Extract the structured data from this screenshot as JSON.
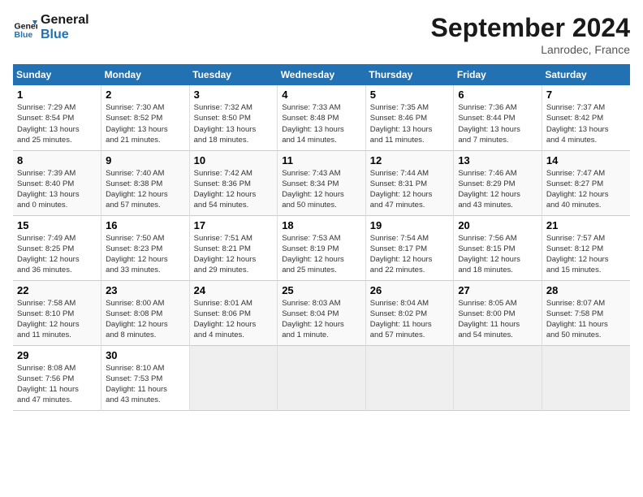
{
  "header": {
    "logo_line1": "General",
    "logo_line2": "Blue",
    "month": "September 2024",
    "location": "Lanrodec, France"
  },
  "days_of_week": [
    "Sunday",
    "Monday",
    "Tuesday",
    "Wednesday",
    "Thursday",
    "Friday",
    "Saturday"
  ],
  "weeks": [
    [
      {
        "day": "1",
        "info": "Sunrise: 7:29 AM\nSunset: 8:54 PM\nDaylight: 13 hours\nand 25 minutes."
      },
      {
        "day": "2",
        "info": "Sunrise: 7:30 AM\nSunset: 8:52 PM\nDaylight: 13 hours\nand 21 minutes."
      },
      {
        "day": "3",
        "info": "Sunrise: 7:32 AM\nSunset: 8:50 PM\nDaylight: 13 hours\nand 18 minutes."
      },
      {
        "day": "4",
        "info": "Sunrise: 7:33 AM\nSunset: 8:48 PM\nDaylight: 13 hours\nand 14 minutes."
      },
      {
        "day": "5",
        "info": "Sunrise: 7:35 AM\nSunset: 8:46 PM\nDaylight: 13 hours\nand 11 minutes."
      },
      {
        "day": "6",
        "info": "Sunrise: 7:36 AM\nSunset: 8:44 PM\nDaylight: 13 hours\nand 7 minutes."
      },
      {
        "day": "7",
        "info": "Sunrise: 7:37 AM\nSunset: 8:42 PM\nDaylight: 13 hours\nand 4 minutes."
      }
    ],
    [
      {
        "day": "8",
        "info": "Sunrise: 7:39 AM\nSunset: 8:40 PM\nDaylight: 13 hours\nand 0 minutes."
      },
      {
        "day": "9",
        "info": "Sunrise: 7:40 AM\nSunset: 8:38 PM\nDaylight: 12 hours\nand 57 minutes."
      },
      {
        "day": "10",
        "info": "Sunrise: 7:42 AM\nSunset: 8:36 PM\nDaylight: 12 hours\nand 54 minutes."
      },
      {
        "day": "11",
        "info": "Sunrise: 7:43 AM\nSunset: 8:34 PM\nDaylight: 12 hours\nand 50 minutes."
      },
      {
        "day": "12",
        "info": "Sunrise: 7:44 AM\nSunset: 8:31 PM\nDaylight: 12 hours\nand 47 minutes."
      },
      {
        "day": "13",
        "info": "Sunrise: 7:46 AM\nSunset: 8:29 PM\nDaylight: 12 hours\nand 43 minutes."
      },
      {
        "day": "14",
        "info": "Sunrise: 7:47 AM\nSunset: 8:27 PM\nDaylight: 12 hours\nand 40 minutes."
      }
    ],
    [
      {
        "day": "15",
        "info": "Sunrise: 7:49 AM\nSunset: 8:25 PM\nDaylight: 12 hours\nand 36 minutes."
      },
      {
        "day": "16",
        "info": "Sunrise: 7:50 AM\nSunset: 8:23 PM\nDaylight: 12 hours\nand 33 minutes."
      },
      {
        "day": "17",
        "info": "Sunrise: 7:51 AM\nSunset: 8:21 PM\nDaylight: 12 hours\nand 29 minutes."
      },
      {
        "day": "18",
        "info": "Sunrise: 7:53 AM\nSunset: 8:19 PM\nDaylight: 12 hours\nand 25 minutes."
      },
      {
        "day": "19",
        "info": "Sunrise: 7:54 AM\nSunset: 8:17 PM\nDaylight: 12 hours\nand 22 minutes."
      },
      {
        "day": "20",
        "info": "Sunrise: 7:56 AM\nSunset: 8:15 PM\nDaylight: 12 hours\nand 18 minutes."
      },
      {
        "day": "21",
        "info": "Sunrise: 7:57 AM\nSunset: 8:12 PM\nDaylight: 12 hours\nand 15 minutes."
      }
    ],
    [
      {
        "day": "22",
        "info": "Sunrise: 7:58 AM\nSunset: 8:10 PM\nDaylight: 12 hours\nand 11 minutes."
      },
      {
        "day": "23",
        "info": "Sunrise: 8:00 AM\nSunset: 8:08 PM\nDaylight: 12 hours\nand 8 minutes."
      },
      {
        "day": "24",
        "info": "Sunrise: 8:01 AM\nSunset: 8:06 PM\nDaylight: 12 hours\nand 4 minutes."
      },
      {
        "day": "25",
        "info": "Sunrise: 8:03 AM\nSunset: 8:04 PM\nDaylight: 12 hours\nand 1 minute."
      },
      {
        "day": "26",
        "info": "Sunrise: 8:04 AM\nSunset: 8:02 PM\nDaylight: 11 hours\nand 57 minutes."
      },
      {
        "day": "27",
        "info": "Sunrise: 8:05 AM\nSunset: 8:00 PM\nDaylight: 11 hours\nand 54 minutes."
      },
      {
        "day": "28",
        "info": "Sunrise: 8:07 AM\nSunset: 7:58 PM\nDaylight: 11 hours\nand 50 minutes."
      }
    ],
    [
      {
        "day": "29",
        "info": "Sunrise: 8:08 AM\nSunset: 7:56 PM\nDaylight: 11 hours\nand 47 minutes."
      },
      {
        "day": "30",
        "info": "Sunrise: 8:10 AM\nSunset: 7:53 PM\nDaylight: 11 hours\nand 43 minutes."
      },
      {
        "day": "",
        "info": ""
      },
      {
        "day": "",
        "info": ""
      },
      {
        "day": "",
        "info": ""
      },
      {
        "day": "",
        "info": ""
      },
      {
        "day": "",
        "info": ""
      }
    ]
  ]
}
